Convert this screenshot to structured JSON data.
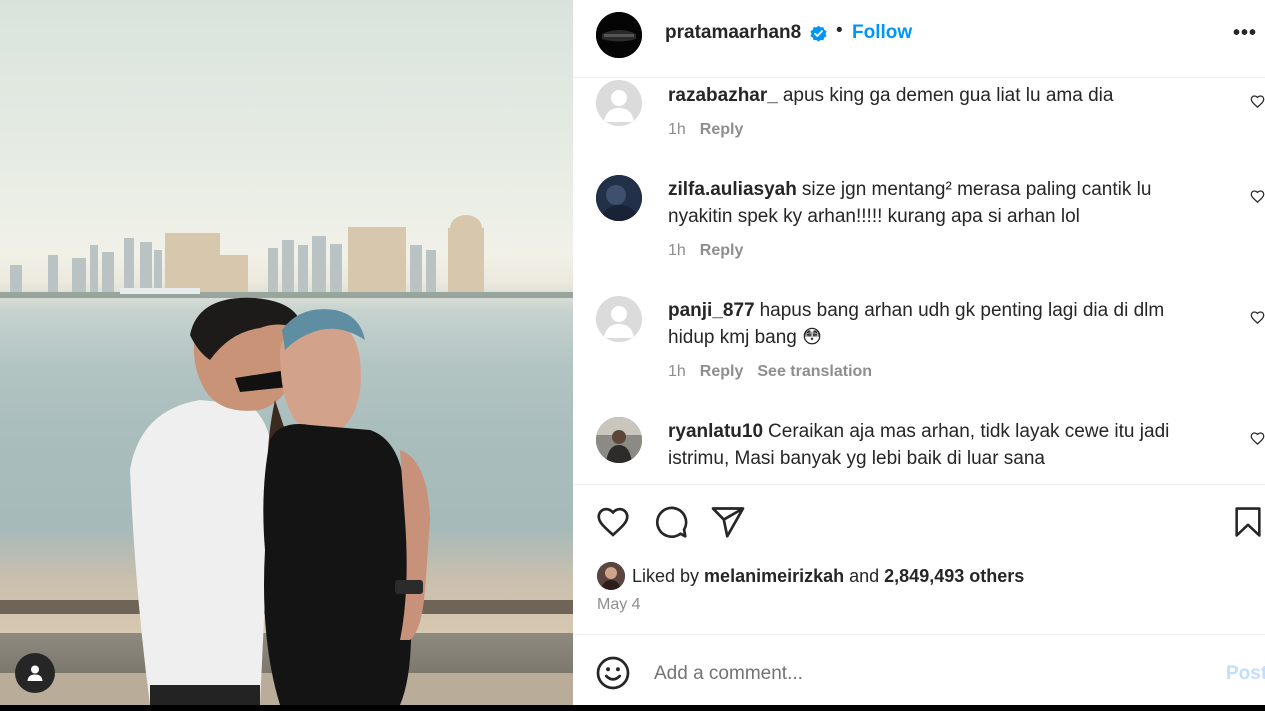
{
  "header": {
    "username": "pratamaarhan8",
    "separator": "•",
    "follow_label": "Follow",
    "more_label": "•••"
  },
  "comments": [
    {
      "username": "razabazhar_",
      "text": "apus king ga demen gua liat lu ama dia",
      "time": "1h",
      "reply_label": "Reply",
      "translation_label": ""
    },
    {
      "username": "zilfa.auliasyah",
      "text": "size jgn mentang² merasa paling cantik lu nyakitin spek ky arhan!!!!! kurang apa si arhan lol",
      "time": "1h",
      "reply_label": "Reply",
      "translation_label": ""
    },
    {
      "username": "panji_877",
      "text": "hapus bang arhan udh gk penting lagi dia di dlm hidup kmj bang 😳",
      "time": "1h",
      "reply_label": "Reply",
      "translation_label": "See translation"
    },
    {
      "username": "ryanlatu10",
      "text": "Ceraikan aja mas arhan, tidk layak cewe itu jadi istrimu, Masi banyak yg lebi baik di luar sana",
      "time": "",
      "reply_label": "",
      "translation_label": ""
    }
  ],
  "likes": {
    "prefix": "Liked by",
    "liker": "melanimeirizkah",
    "conjunction": "and",
    "count": "2,849,493 others"
  },
  "date": "May 4",
  "add_comment": {
    "placeholder": "Add a comment...",
    "post_label": "Post"
  },
  "colors": {
    "accent": "#0095f6",
    "verified": "#0095f6",
    "post_disabled": "#c0dffd"
  },
  "icons": [
    "verified-badge-icon",
    "heart-icon",
    "comment-icon",
    "share-icon",
    "bookmark-icon",
    "emoji-icon",
    "user-icon"
  ]
}
